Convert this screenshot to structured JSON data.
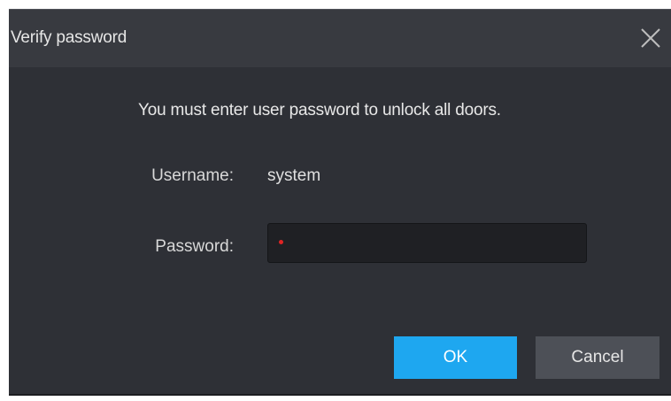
{
  "dialog": {
    "title": "Verify password",
    "close_icon": "close-icon",
    "message": "You must enter user password to unlock all doors.",
    "username_label": "Username:",
    "username_value": "system",
    "password_label": "Password:",
    "password_value": "",
    "password_placeholder": "",
    "ok_label": "OK",
    "cancel_label": "Cancel"
  },
  "colors": {
    "accent": "#1ea7f0",
    "background": "#2e3036",
    "titlebar": "#383a40",
    "required_mark": "#e02424"
  }
}
